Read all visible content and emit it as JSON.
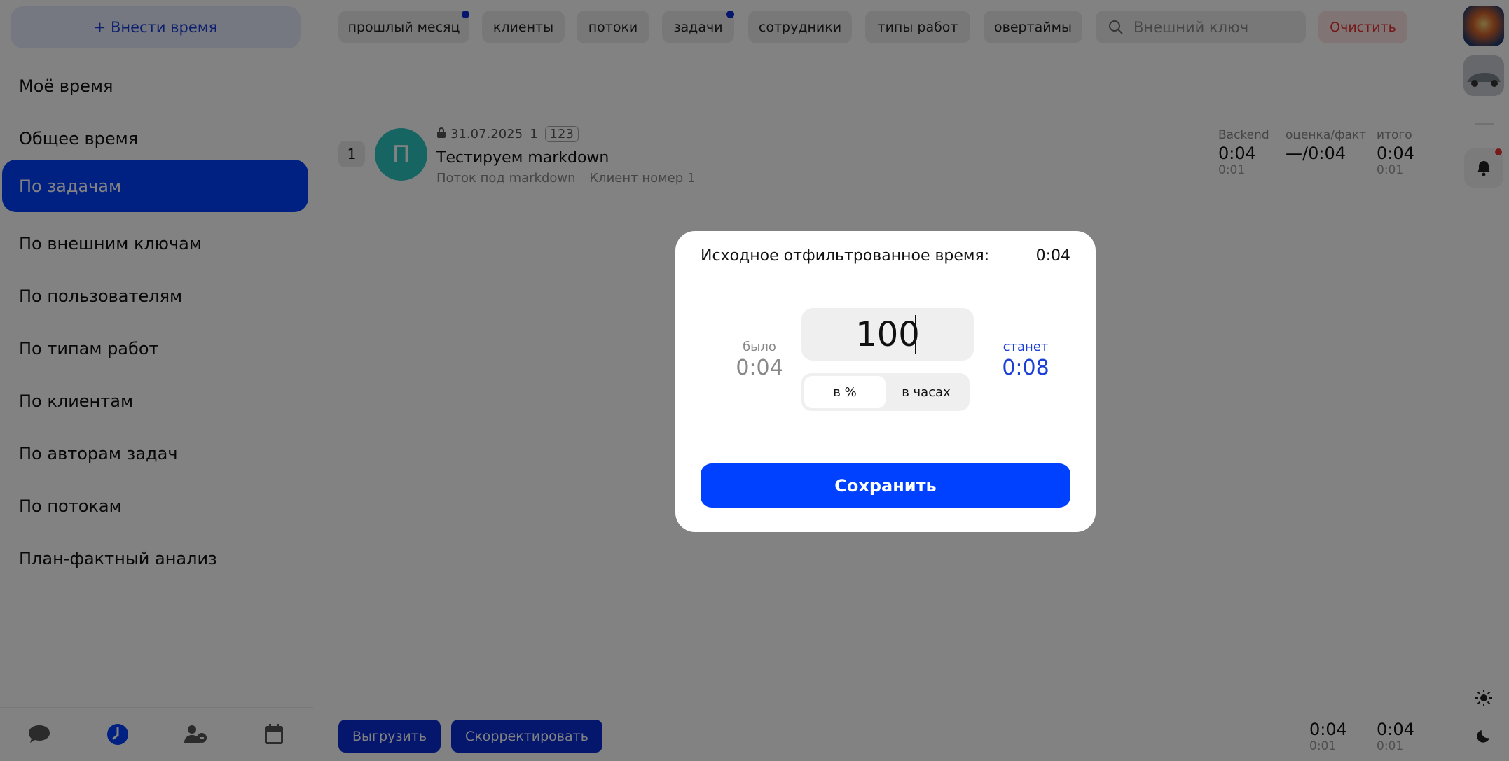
{
  "sidebar": {
    "add_time_label": "+ Внести время",
    "items": [
      {
        "label": "Моё время"
      },
      {
        "label": "Общее время"
      },
      {
        "label": "По задачам",
        "active": true
      },
      {
        "label": "По внешним ключам"
      },
      {
        "label": "По пользователям"
      },
      {
        "label": "По типам работ"
      },
      {
        "label": "По клиентам"
      },
      {
        "label": "По авторам задач"
      },
      {
        "label": "По потокам"
      },
      {
        "label": "План-фактный анализ"
      }
    ],
    "bottom_icons": [
      "chat-icon",
      "clock-icon",
      "users-icon",
      "calendar-icon"
    ]
  },
  "filters": {
    "chips": [
      {
        "label": "прошлый месяц",
        "dot": true
      },
      {
        "label": "клиенты"
      },
      {
        "label": "потоки"
      },
      {
        "label": "задачи",
        "dot": true
      },
      {
        "label": "сотрудники"
      },
      {
        "label": "типы работ"
      },
      {
        "label": "овертаймы"
      }
    ],
    "search_placeholder": "Внешний ключ",
    "clear_label": "Очистить"
  },
  "task_row": {
    "index": "1",
    "avatar_letter": "П",
    "date": "31.07.2025",
    "count": "1",
    "tag": "123",
    "title": "Тестируем markdown",
    "stream": "Поток под markdown",
    "client": "Клиент номер 1",
    "stats": [
      {
        "header": "Backend",
        "value": "0:04",
        "sub": "0:01"
      },
      {
        "header": "оценка/факт",
        "value": "—/0:04",
        "sub": ""
      },
      {
        "header": "итого",
        "value": "0:04",
        "sub": "0:01"
      }
    ]
  },
  "bottom": {
    "export_label": "Выгрузить",
    "correct_label": "Скорректировать",
    "totals": [
      {
        "value": "0:04",
        "sub": "0:01"
      },
      {
        "value": "0:04",
        "sub": "0:01"
      }
    ]
  },
  "modal": {
    "header_label": "Исходное отфильтрованное время:",
    "header_value": "0:04",
    "was_label": "было",
    "was_value": "0:04",
    "input_value": "100",
    "becomes_label": "станет",
    "becomes_value": "0:08",
    "mode_percent": "в %",
    "mode_hours": "в часах",
    "save_label": "Сохранить"
  },
  "colors": {
    "accent": "#0040ff",
    "danger": "#e53030",
    "avatar": "#2ec7c0"
  }
}
